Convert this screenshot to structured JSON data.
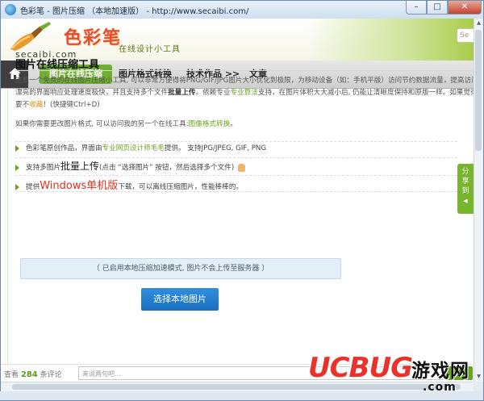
{
  "window": {
    "title": "色彩笔 - 图片压缩 （本地加速版） - http://www.secaibi.com/",
    "minimize": "–",
    "maximize": "□",
    "close": "✕"
  },
  "header": {
    "logo_text": "色彩笔",
    "domain": "secaibi.com",
    "slogan": "在线设计小工具",
    "search_placeholder": "Se"
  },
  "nav": {
    "items": [
      {
        "label": "图片在线压缩",
        "active": true
      },
      {
        "label": "图片格式转换",
        "active": false
      },
      {
        "label": "技术作品 >>",
        "active": false
      },
      {
        "label": "文章",
        "active": false
      }
    ]
  },
  "main": {
    "title": "图片在线压缩工具",
    "intro_l1": "这是一个免费的在线图片压缩小工具, 可以非常方便得将PNG/GIF/JPG图片大小优化到极限，为移动设备（如：手机平版）访问节约数据流量，提高访问",
    "intro_l2_a": "漂亮的界面响应处理速度极快，并且支持多个文件",
    "intro_l2_bold": "批量上传",
    "intro_l2_b": "。依赖专业",
    "intro_l2_algo": "专业算法",
    "intro_l2_c": "支持，在图片体积大大减小后, 仍能让清晰度保持和原版一样。如果觉得",
    "intro_l3_a": "要不",
    "intro_l3_fav": "收藏",
    "intro_l3_b": "！(快捷键Ctrl+D)",
    "alt_text": "如果你需要更改图片格式, 可以访问我的另一个在线工具:",
    "alt_link": "图像格式转换",
    "alt_end": "。",
    "feature1_a": "色彩笔原创作品，界面由",
    "feature1_link": "专业网页设计师毛毛",
    "feature1_b": "提供。 支持JPG/JPEG, GIF, PNG",
    "feature2_a": "支持多图片",
    "feature2_big": "批量上传",
    "feature2_b": "(点击 “选择图片” 按钮，然后选择多个文件)",
    "feature3_a": "提供",
    "feature3_big": "Windows单机版",
    "feature3_b": "下载，可以离线压缩图片，性能棒棒的。",
    "notice": "（ 已启用本地压缩加速模式, 图片不会上传至服务器 ）",
    "pick_button": "选择本地图片"
  },
  "share": {
    "label": "分享到",
    "arrow": "◀"
  },
  "comment": {
    "prefix": "查看",
    "count": "284",
    "suffix": "条评论",
    "placeholder": "来说两句吧..."
  },
  "watermark": {
    "brand": "UCBUG",
    "cn": "游戏网",
    "com": ".com"
  }
}
